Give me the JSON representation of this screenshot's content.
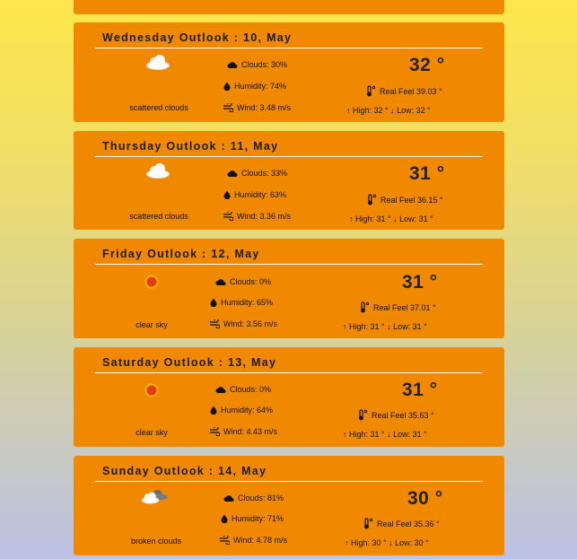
{
  "days": [
    {
      "title": "Wednesday Outlook : 10, May",
      "icon": "scattered-clouds-icon",
      "description": "scattered clouds",
      "clouds": "Clouds: 30%",
      "humidity": "Humidity: 74%",
      "wind": "Wind: 3.48 m/s",
      "temp": "32 °",
      "real_feel": "Real Feel 39.03 °",
      "high": "↑ High: 32 °",
      "low": "↓ Low: 32 °"
    },
    {
      "title": "Thursday Outlook : 11, May",
      "icon": "scattered-clouds-icon",
      "description": "scattered clouds",
      "clouds": "Clouds: 33%",
      "humidity": "Humidity: 63%",
      "wind": "Wind: 3.36 m/s",
      "temp": "31 °",
      "real_feel": "Real Feel 36.15 °",
      "high": "↑ High: 31 °",
      "low": "↓ Low: 31 °"
    },
    {
      "title": "Friday Outlook : 12, May",
      "icon": "clear-sky-sun-icon",
      "description": "clear sky",
      "clouds": "Clouds: 0%",
      "humidity": "Humidity: 65%",
      "wind": "Wind: 3.56 m/s",
      "temp": "31 °",
      "real_feel": "Real Feel 37.01 °",
      "high": "↑ High: 31 °",
      "low": "↓ Low: 31 °"
    },
    {
      "title": "Saturday Outlook : 13, May",
      "icon": "clear-sky-sun-icon",
      "description": "clear sky",
      "clouds": "Clouds: 0%",
      "humidity": "Humidity: 64%",
      "wind": "Wind: 4.43 m/s",
      "temp": "31 °",
      "real_feel": "Real Feel 35.63 °",
      "high": "↑ High: 31 °",
      "low": "↓ Low: 31 °"
    },
    {
      "title": "Sunday Outlook : 14, May",
      "icon": "broken-clouds-icon",
      "description": "broken clouds",
      "clouds": "Clouds: 81%",
      "humidity": "Humidity: 71%",
      "wind": "Wind: 4.78 m/s",
      "temp": "30 °",
      "real_feel": "Real Feel 35.36 °",
      "high": "↑ High: 30 °",
      "low": "↓ Low: 30 °"
    }
  ],
  "colors": {
    "card": "#f18900",
    "page_top": "#fde74c",
    "page_bottom": "#bcc1e6"
  }
}
